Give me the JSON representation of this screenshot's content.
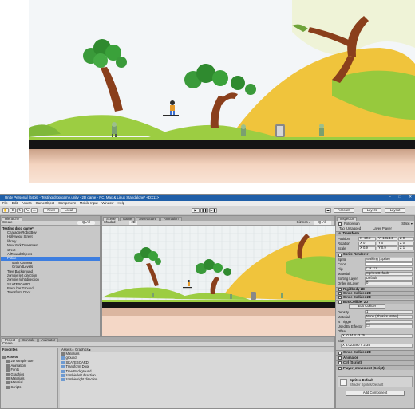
{
  "window": {
    "title": "Unity Personal (64bit) - Testing drop game.unity - 2D game - PC, Mac & Linux Standalone* <DX11>",
    "minimize": "–",
    "maximize": "□",
    "close": "✕"
  },
  "menu": [
    "File",
    "Edit",
    "Assets",
    "GameObject",
    "Component",
    "Mobile Input",
    "Window",
    "Help"
  ],
  "toolbar": {
    "pivot": "Pivot",
    "local": "Local",
    "play": "▶",
    "pause": "❚❚",
    "step": "▶❚",
    "account": "Account",
    "layers": "Layers",
    "layout": "Layout"
  },
  "hierarchy": {
    "tab": "Hierarchy",
    "create": "Create",
    "search": "Q▾All",
    "items": [
      {
        "label": "Testing drop game*",
        "indent": 0,
        "selected": false
      },
      {
        "label": "CharacterRobotBoy",
        "indent": 1,
        "selected": false
      },
      {
        "label": "Hollywood Street",
        "indent": 1,
        "selected": false
      },
      {
        "label": "library",
        "indent": 1,
        "selected": false
      },
      {
        "label": "New York Downtown",
        "indent": 1,
        "selected": false
      },
      {
        "label": "street",
        "indent": 1,
        "selected": false
      },
      {
        "label": "AllRoundObjects",
        "indent": 1,
        "selected": false
      },
      {
        "label": "Police",
        "indent": 1,
        "selected": true
      },
      {
        "label": "Main Camera",
        "indent": 2,
        "selected": false
      },
      {
        "label": "GroundLevels",
        "indent": 2,
        "selected": false
      },
      {
        "label": "Tree Background",
        "indent": 1,
        "selected": false
      },
      {
        "label": "zombie left direction",
        "indent": 1,
        "selected": false
      },
      {
        "label": "zombie right direction",
        "indent": 1,
        "selected": false
      },
      {
        "label": "SKATEBOARD",
        "indent": 1,
        "selected": false
      },
      {
        "label": "Black bar Ground",
        "indent": 1,
        "selected": false
      },
      {
        "label": "Transform Door",
        "indent": 1,
        "selected": false
      }
    ]
  },
  "scene": {
    "tabs": [
      "Scene",
      "Game",
      "Asset Store",
      "Animation"
    ],
    "shading": "Shaded",
    "mode": "2D",
    "gizmos": "Gizmos ▾",
    "search": "Q▾All"
  },
  "project": {
    "tabs": [
      "Project",
      "Console",
      "Animator"
    ],
    "create": "Create",
    "favorites": "Favorites",
    "tree": [
      "Assets",
      "2D sample use",
      "Animation",
      "Fonts",
      "Graphics",
      "Materials",
      "Material",
      "Scripts"
    ],
    "breadcrumb": "Assets ▸ Graphics ▸",
    "files": [
      "Materials",
      "ground",
      "SKATEBOARD",
      "Transform Door",
      "Tree Background",
      "zombie left direction",
      "zombie right direction"
    ]
  },
  "inspector": {
    "tab": "Inspector",
    "name": "Policeman",
    "static": "Static ▾",
    "tag_label": "Tag",
    "tag": "Untagged",
    "layer_label": "Layer",
    "layer": "Player",
    "transform": {
      "title": "Transform",
      "position_label": "Position",
      "position": [
        "X -20.2",
        "Y -131.14",
        "Z 0"
      ],
      "rotation_label": "Rotation",
      "rotation": [
        "X 0",
        "Y 0",
        "Z 0"
      ],
      "scale_label": "Scale",
      "scale": [
        "X 0.9",
        "Y 0.9",
        "Z 1"
      ]
    },
    "sprite": {
      "title": "Sprite Renderer",
      "rows": [
        [
          "Sprite",
          "Walking (Sprite)"
        ],
        [
          "Color",
          ""
        ],
        [
          "Flip",
          "☐X ☐Y"
        ],
        [
          "Material",
          "Sprites-Default"
        ],
        [
          "Sorting Layer",
          "Default"
        ],
        [
          "Order in Layer",
          "0"
        ]
      ]
    },
    "components": [
      "Rigidbody 2D",
      "Circle Collider 2D",
      "Circle Collider 2D",
      "Box Collider 2D"
    ],
    "box": {
      "edit": "Edit Collider",
      "rows": [
        [
          "Density",
          "1"
        ],
        [
          "Material",
          "None (Physics Mater)"
        ],
        [
          "Is Trigger",
          "☐"
        ],
        [
          "Used By Effector",
          "☐"
        ],
        [
          "Offset",
          ""
        ],
        [
          "",
          "X -0.34      Y -3.76"
        ],
        [
          "Size",
          ""
        ],
        [
          "",
          "X 3.023390   Y 2.34"
        ]
      ]
    },
    "after": [
      "Circle Collider 2D",
      "Animator",
      "Ctrl (Script)",
      "Player_movement (Script)"
    ],
    "material_name": "Sprites-Default",
    "shader": "Shader  Sprites/Default",
    "add_component": "Add Component"
  },
  "colors": {
    "sky": "#f3f6f8",
    "hill_green": "#97c93d",
    "sand": "#f0c43c",
    "road": "#141414",
    "dirt": "#f6d6c1",
    "selection": "#3d7ee0",
    "titlebar": "#1f5fa8"
  }
}
